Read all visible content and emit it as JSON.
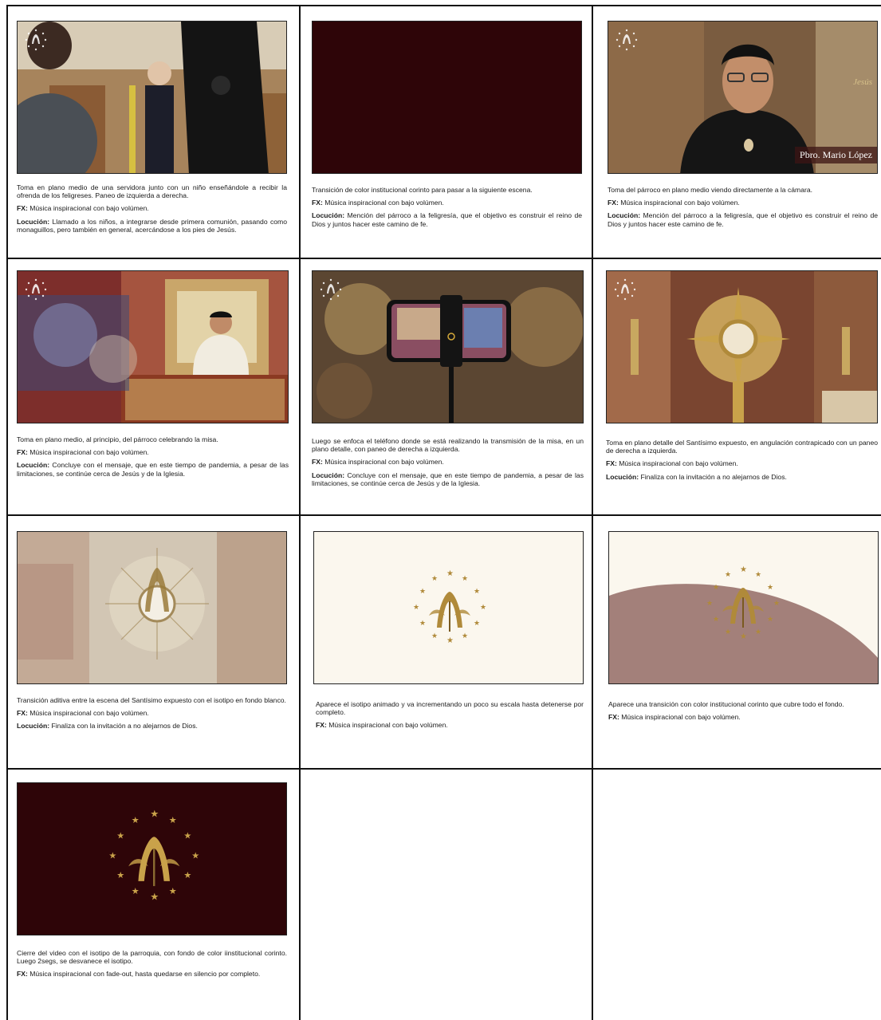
{
  "cells": [
    {
      "desc": "Toma en plano medio de una servidora junto con un niño enseñándole a recibir la ofrenda de los feligreses. Paneo de izquierda a derecha.",
      "fx_label": "FX:",
      "fx": "Música inspiracional con bajo volúmen.",
      "loc_label": "Locución:",
      "loc": "Llamado a los niños, a integrarse desde primera comunión, pasando como monaguillos, pero también en general, acercándose a los pies de Jesús."
    },
    {
      "desc": "Transición de color institucional corinto para pasar a la siguiente escena.",
      "fx_label": "FX:",
      "fx": "Música inspiracional con bajo volúmen.",
      "loc_label": "Locución:",
      "loc": "Mención del párroco a la feligresía, que el objetivo es construir el reino de Dios y juntos hacer este camino de fe."
    },
    {
      "desc": "Toma del párroco en plano medio viendo directamente a la cámara.",
      "fx_label": "FX:",
      "fx": "Música inspiracional con bajo volúmen.",
      "loc_label": "Locución:",
      "loc": "Mención del párroco a la feligresía, que el objetivo es construir el reino de Dios y juntos hacer este camino de fe.",
      "caption": "Pbro. Mario López",
      "sign": "Jesús"
    },
    {
      "desc": "Toma en plano medio, al principio, del párroco celebrando la misa.",
      "fx_label": "FX:",
      "fx": "Música inspiracional con bajo volúmen.",
      "loc_label": "Locución:",
      "loc": "Concluye con el mensaje, que en este tiempo de pandemia, a pesar de las limitaciones, se continúe cerca de Jesús y de la Iglesia."
    },
    {
      "desc": "Luego se enfoca el teléfono donde se está realizando la transmisión de la misa, en un plano detalle, con paneo de derecha a izquierda.",
      "fx_label": "FX:",
      "fx": "Música inspiracional con bajo volúmen.",
      "loc_label": "Locución:",
      "loc": "Concluye con el mensaje, que en este tiempo de pandemia, a pesar de las limitaciones, se continúe cerca de Jesús y de la Iglesia."
    },
    {
      "desc": "Toma en plano detalle del Santísimo expuesto, en angulación contrapicado con un paneo de derecha a izquierda.",
      "fx_label": "FX:",
      "fx": "Música inspiracional con bajo volúmen.",
      "loc_label": "Locución:",
      "loc": "Finaliza con la invitación a no alejarnos de Dios."
    },
    {
      "desc": "Transición aditiva entre la escena del Santísimo expuesto con el isotipo en fondo blanco.",
      "fx_label": "FX:",
      "fx": "Música inspiracional con bajo volúmen.",
      "loc_label": "Locución:",
      "loc": "Finaliza con la invitación a no alejarnos de Dios."
    },
    {
      "desc": "Aparece el isotipo animado y va  incrementando un poco su escala hasta detenerse por completo.",
      "fx_label": "FX:",
      "fx": "Música inspiracional con bajo volúmen."
    },
    {
      "desc": "Aparece una transición con color institucional corinto que cubre todo el fondo.",
      "fx_label": "FX:",
      "fx": "Música inspiracional con bajo volúmen."
    },
    {
      "desc": "Cierre del video con el isotipo de la parroquia, con fondo de color iinstitucional corinto. Luego 2segs, se desvanece el isotipo.",
      "fx_label": "FX:",
      "fx": "Música inspiracional con fade-out, hasta quedarse en silencio por completo."
    }
  ],
  "colors": {
    "corinto": "#2e0508",
    "cream": "#fbf7ee",
    "gold": "#b08a3a",
    "mauve": "#a3807a"
  }
}
